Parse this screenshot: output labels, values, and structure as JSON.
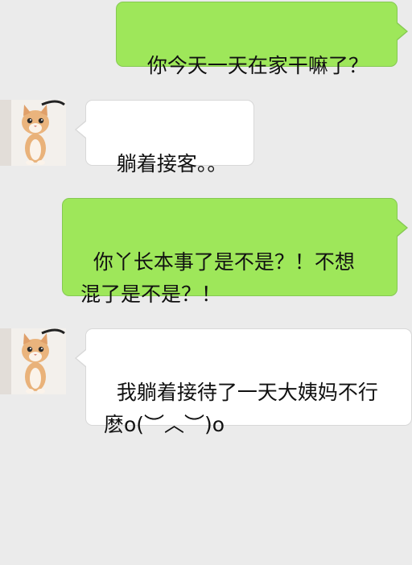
{
  "chat": {
    "messages": [
      {
        "side": "out",
        "text": "你今天一天在家干嘛了？"
      },
      {
        "side": "in",
        "text": "躺着接客。。",
        "avatar": "kitten-avatar"
      },
      {
        "side": "out",
        "text": "你丫长本事了是不是？！不想\n混了是不是？！"
      },
      {
        "side": "in",
        "text": "我躺着接待了一天大姨妈不行\n麽o(︶︿︶)o",
        "avatar": "kitten-avatar"
      }
    ]
  },
  "colors": {
    "background": "#ebebeb",
    "outgoing_bubble": "#9ee75a",
    "incoming_bubble": "#ffffff"
  }
}
